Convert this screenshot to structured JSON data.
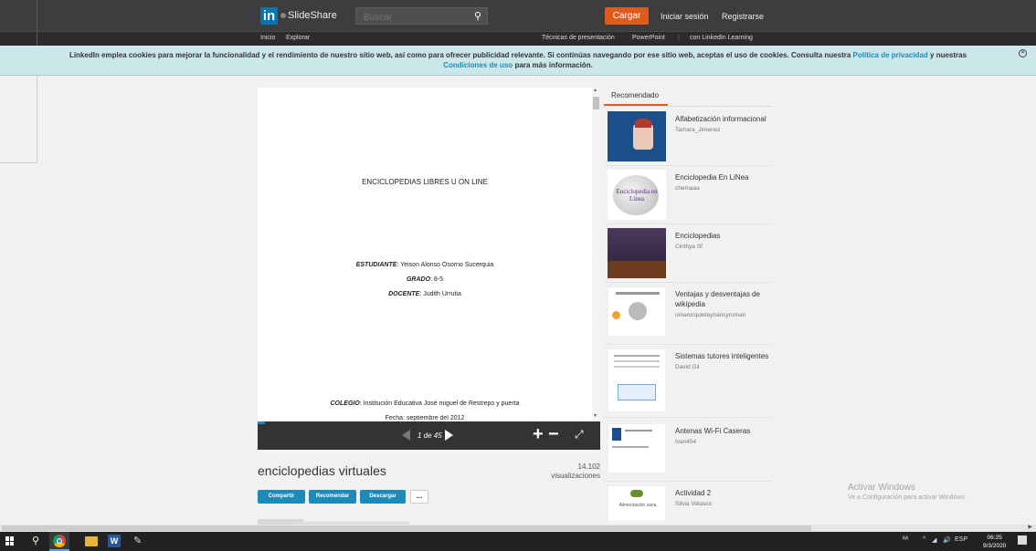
{
  "header": {
    "logo_text": "in",
    "brand": "SlideShare",
    "search_placeholder": "Buscar",
    "upload_label": "Cargar",
    "login_label": "Iniciar sesión",
    "register_label": "Registrarse"
  },
  "subnav": {
    "home": "Inicio",
    "explore": "Explorar",
    "presentation_techniques": "Técnicas de presentación",
    "powerpoint": "PowerPoint",
    "linkedin_learning": "con LinkedIn Learning"
  },
  "cookie": {
    "text": "LinkedIn emplea cookies para mejorar la funcionalidad y el rendimiento de nuestro sitio web, así como para ofrecer publicidad relevante. Si continúas navegando por ese sitio web, aceptas el uso de cookies. Consulta nuestra",
    "privacy_link": "Política de privacidad",
    "and": "y nuestras",
    "terms_link": "Condiciones de uso",
    "suffix": "para más información."
  },
  "document": {
    "title": "ENCICLOPEDIAS LIBRES U ON LINE",
    "student_label": "ESTUDIANTE",
    "student_value": ": Yeison Alonso Osorno Sucerquia",
    "grade_label": "GRADO",
    "grade_value": ": 8-5",
    "teacher_label": "DOCENTE",
    "teacher_value": ": Judith Urrutia",
    "school_label": "COLEGIO",
    "school_value": ": Institución Educativa José miguel de Restrepo y puerta",
    "date_partial": "Fecha: septiembre del 2012"
  },
  "viewer": {
    "page_indicator": "1 de 45",
    "progress_fraction": 0.022
  },
  "slide_info": {
    "name": "enciclopedias virtuales",
    "views_count": "14.102",
    "views_label": "visualizaciones",
    "share": "Compartir",
    "recommend": "Recomendar",
    "download": "Descargar",
    "more": "..."
  },
  "recommended": {
    "tab": "Recomendado",
    "items": [
      {
        "title": "Alfabetización informacional",
        "author": "Tamara_Jimenez"
      },
      {
        "title": "Enciclopedia En LiNea",
        "author": "chemaaa"
      },
      {
        "title": "Enciclopedias",
        "author": "Cinthya Sf"
      },
      {
        "title": "Ventajas y desventajas de wikipedia",
        "author": "omarurquietaynancyroman"
      },
      {
        "title": "Sistemas tutores inteligentes",
        "author": "David Gil"
      },
      {
        "title": "Antenas Wi-Fi Caseras",
        "author": "Ivan454"
      },
      {
        "title": "Actividad 2",
        "author": "Silvia Velasco"
      }
    ],
    "thumb_texts": {
      "wiki_logo": "Enciclopedia en Línea",
      "alimentacion": "Alimentación sana"
    }
  },
  "windows": {
    "activate_title": "Activar Windows",
    "activate_sub": "Ve a Configuración para activar Windows.",
    "lang": "ESP",
    "time": "06:25",
    "date": "9/3/2020"
  },
  "colors": {
    "header_bg": "#3d3d3d",
    "linkedin_blue": "#0077b5",
    "upload_orange": "#e05a1c",
    "action_blue": "#1d8bb7",
    "cookie_bg": "#cce7ea"
  }
}
